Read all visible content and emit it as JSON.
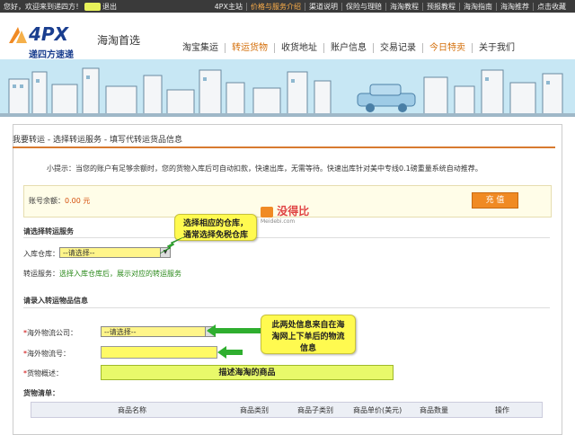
{
  "topbar": {
    "greeting": "您好，欢迎来到递四方！",
    "logout": "退出",
    "links": [
      "4PX主站",
      "价格与服务介绍",
      "渠道说明",
      "保险与理赔",
      "海淘教程",
      "预报教程",
      "海淘指南",
      "海淘推荐",
      "点击收藏"
    ]
  },
  "logo": {
    "brand": "4PX",
    "company": "递四方速递",
    "slogan": "海淘首选"
  },
  "nav": {
    "items": [
      "淘宝集运",
      "转运货物",
      "收货地址",
      "账户信息",
      "交易记录",
      "今日特卖",
      "关于我们"
    ]
  },
  "breadcrumb": "我要转运 - 选择转运服务 - 填写代转运货品信息",
  "tip": "小提示：当您的账户有足够余额时，您的货物入库后可自动扣款，快速出库，无需等待。快速出库针对美中专线0.1磅重量系统自动推荐。",
  "balance": {
    "label": "账号余额：",
    "value": "0.00 元",
    "button": "充 值"
  },
  "section1": {
    "title": "请选择转运服务",
    "warehouse_label": "入库仓库：",
    "warehouse_value": "--请选择--",
    "service_label": "转运服务：",
    "service_value": "选择入库仓库后，展示对应的转运服务"
  },
  "bubble1": {
    "line1": "选择相应的仓库，",
    "line2": "通常选择免税仓库"
  },
  "watermark": {
    "text": "没得比",
    "sub": "Meidebi.com"
  },
  "section2": {
    "title": "请录入转运物品信息",
    "company_label": "海外物流公司：",
    "company_value": "--请选择--",
    "tracking_label": "海外物流号：",
    "desc_label": "货物概述：",
    "desc_hint": "描述海淘的商品",
    "list_label": "货物清单："
  },
  "bubble2": {
    "line1": "此两处信息来自在海",
    "line2": "淘网上下单后的物流",
    "line3": "信息"
  },
  "table": {
    "headers": [
      "商品名称",
      "商品类别",
      "商品子类别",
      "商品单价(美元)",
      "商品数量",
      "操作"
    ]
  },
  "colors": {
    "accent": "#f08a24",
    "brand": "#1a3e8f",
    "highlight": "#fffa50"
  }
}
